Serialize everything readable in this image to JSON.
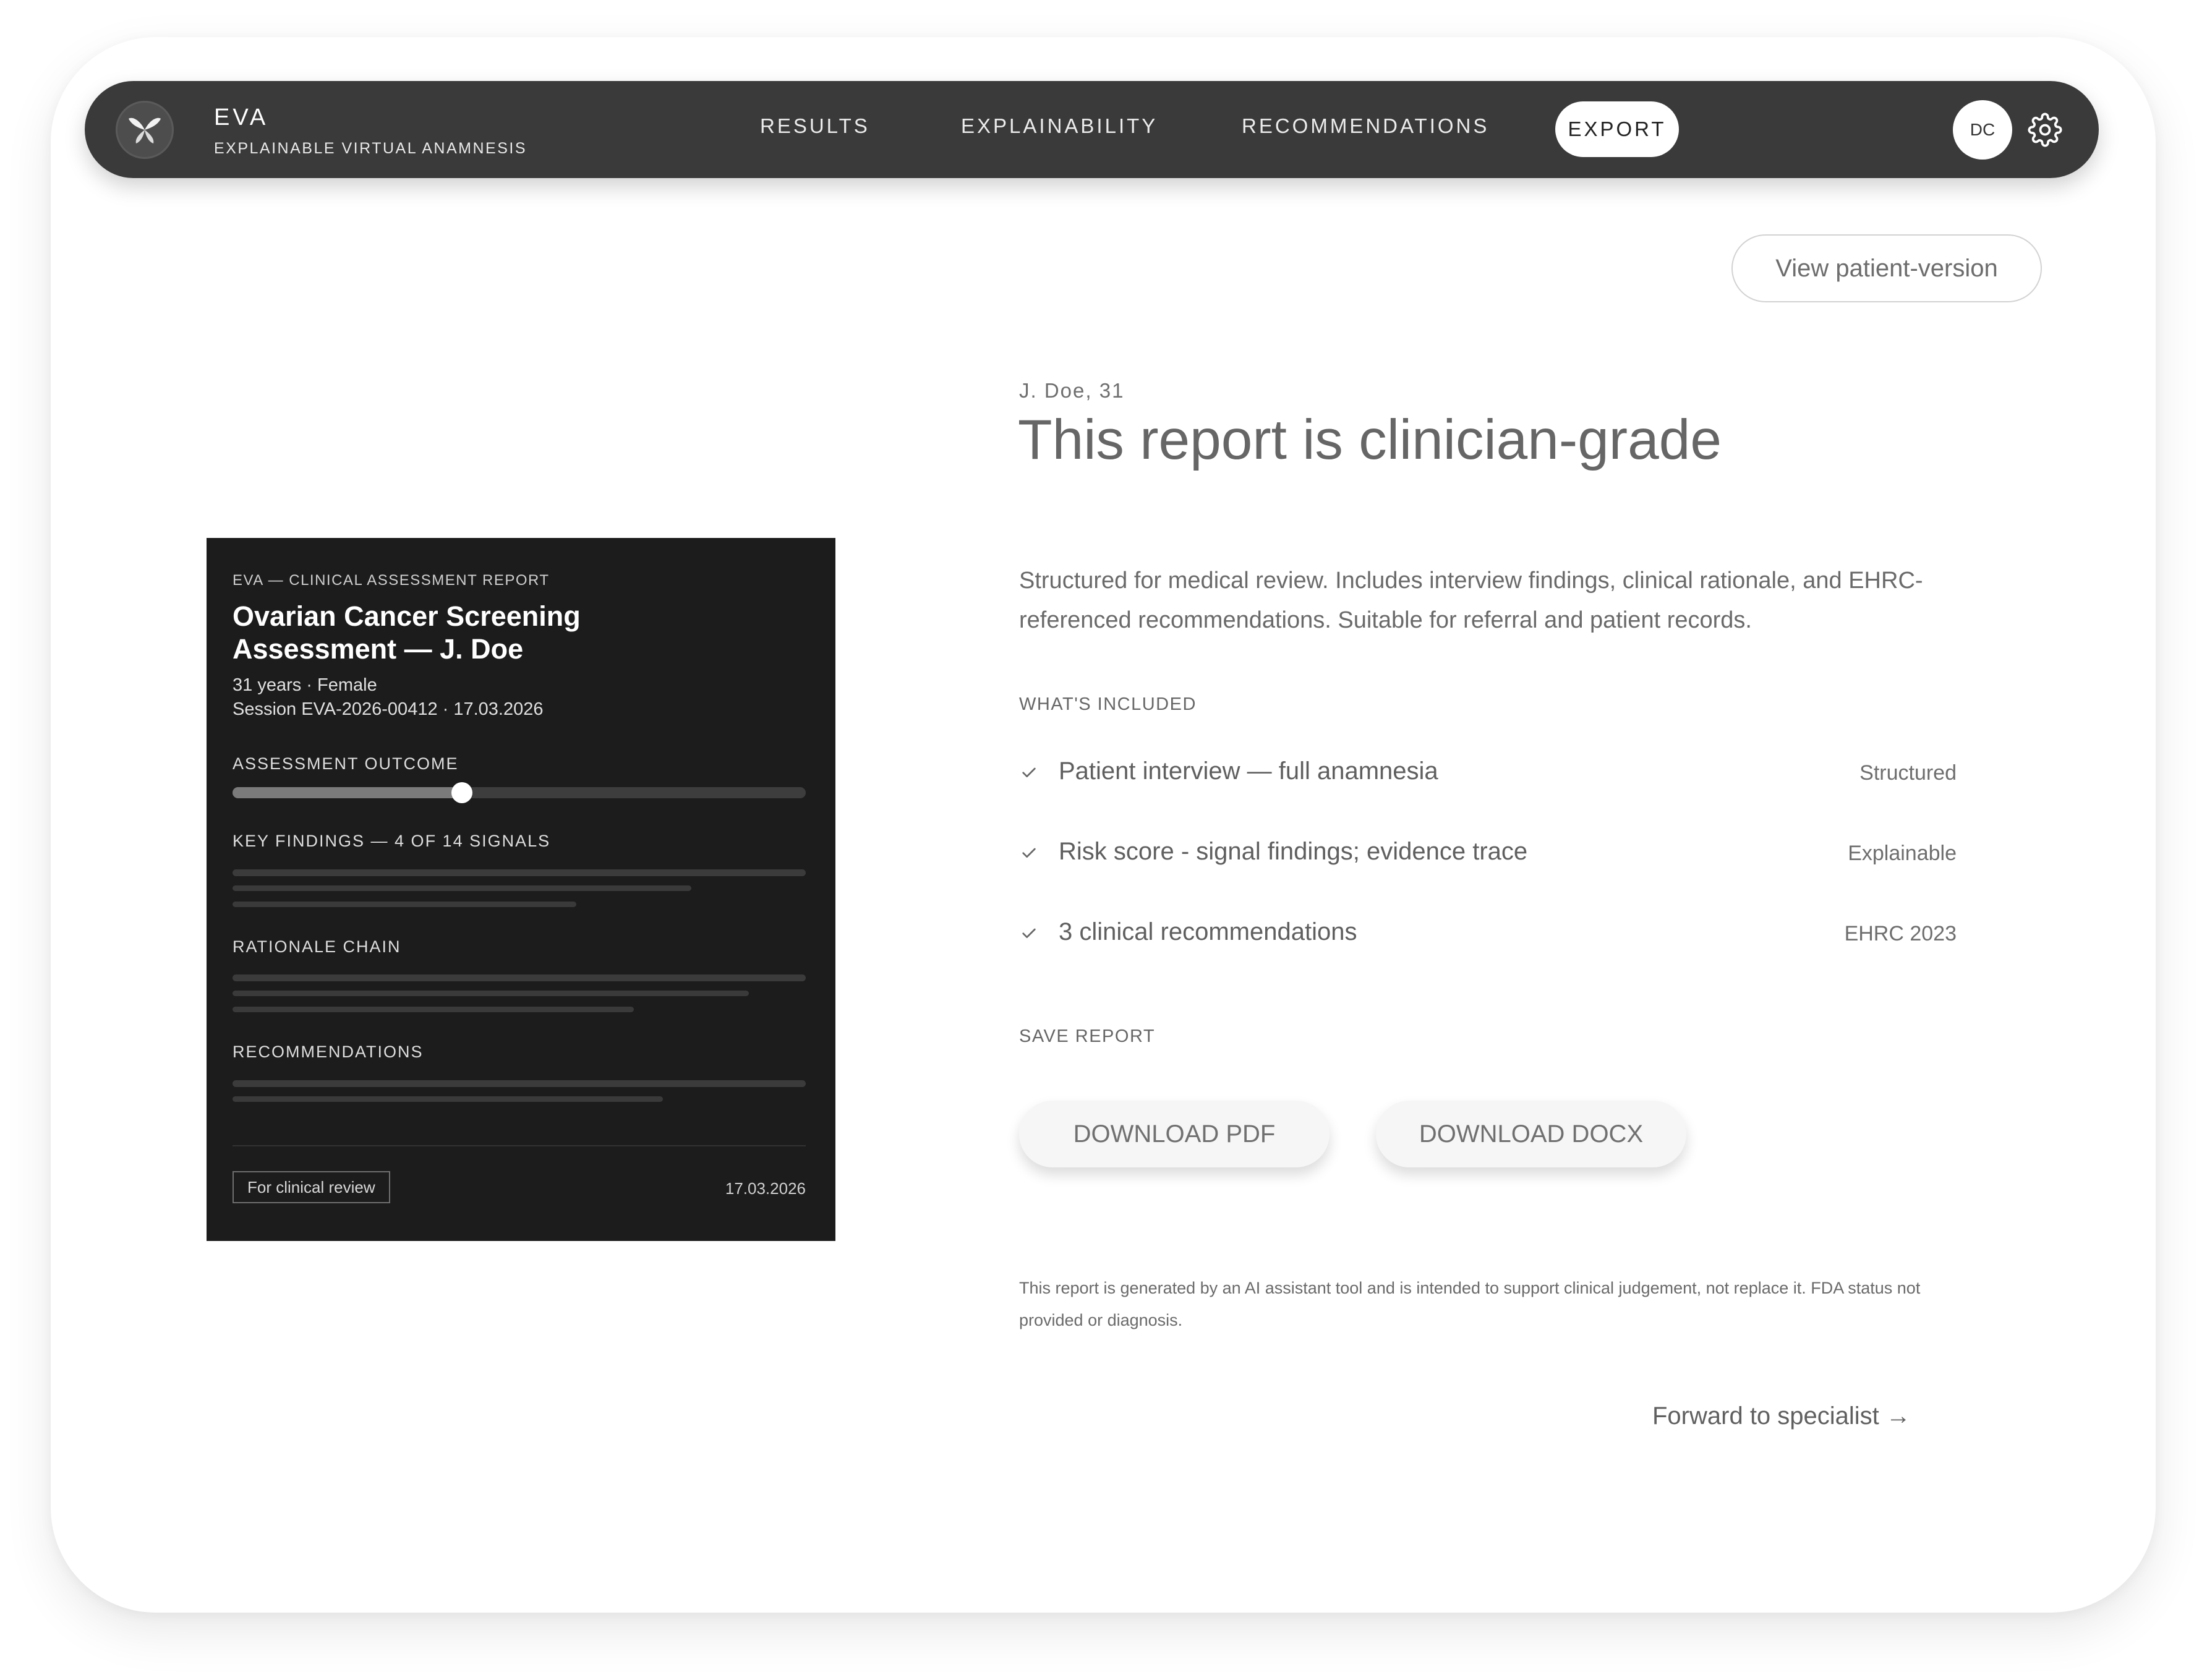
{
  "app": {
    "name": "EVA",
    "subtitle": "EXPLAINABLE VIRTUAL ANAMNESIS"
  },
  "nav": {
    "tabs": [
      {
        "label": "RESULTS"
      },
      {
        "label": "EXPLAINABILITY"
      },
      {
        "label": "RECOMMENDATIONS"
      },
      {
        "label": "EXPORT",
        "active": true
      }
    ],
    "avatar_initials": "DC",
    "settings_icon": "gear-icon",
    "logo_icon": "butterfly-logo-icon"
  },
  "view_patient_button": "View patient-version",
  "report_preview": {
    "kicker": "EVA — CLINICAL ASSESSMENT REPORT",
    "title": "Ovarian Cancer Screening Assessment — J. Doe",
    "meta_line1": "31 years · Female",
    "meta_line2": "Session EVA-2026-00412 · 17.03.2026",
    "outcome_label": "ASSESSMENT OUTCOME",
    "outcome_level": 0.4,
    "findings_label": "KEY FINDINGS — 4 OF 14 SIGNALS",
    "rationale_label": "RATIONALE CHAIN",
    "recommendations_label": "RECOMMENDATIONS",
    "tag": "For clinical review",
    "date": "17.03.2026"
  },
  "main": {
    "patient": "J. Doe, 31",
    "headline": "This report is clinician-grade",
    "description": "Structured for medical review. Includes interview findings, clinical rationale, and EHRC-referenced recommendations. Suitable for referral and patient records.",
    "included_label": "WHAT'S INCLUDED",
    "included": [
      {
        "text": "Patient interview — full anamnesia",
        "tag": "Structured"
      },
      {
        "text": "Risk score - signal findings; evidence trace",
        "tag": "Explainable"
      },
      {
        "text": "3 clinical recommendations",
        "tag": "EHRC 2023"
      }
    ],
    "save_label": "SAVE REPORT",
    "download_pdf": "DOWNLOAD PDF",
    "download_docx": "DOWNLOAD DOCX",
    "disclaimer": "This report is generated by an AI assistant tool and is intended to support clinical judgement, not replace it. FDA status not provided or diagnosis.",
    "forward": "Forward to specialist →"
  },
  "colors": {
    "nav_bg": "#3a3a3a",
    "doc_bg": "#1c1c1c",
    "text_gray": "#666666"
  }
}
